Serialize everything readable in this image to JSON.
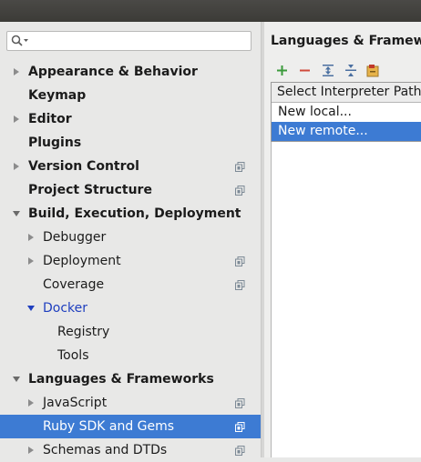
{
  "search": {
    "value": "",
    "placeholder": ""
  },
  "tree": [
    {
      "label": "Appearance & Behavior",
      "bold": true,
      "expander": "collapsed",
      "indent": 0,
      "project": false
    },
    {
      "label": "Keymap",
      "bold": true,
      "expander": "none",
      "indent": 0,
      "project": false
    },
    {
      "label": "Editor",
      "bold": true,
      "expander": "collapsed",
      "indent": 0,
      "project": false
    },
    {
      "label": "Plugins",
      "bold": true,
      "expander": "none",
      "indent": 0,
      "project": false
    },
    {
      "label": "Version Control",
      "bold": true,
      "expander": "collapsed",
      "indent": 0,
      "project": true
    },
    {
      "label": "Project Structure",
      "bold": true,
      "expander": "none",
      "indent": 0,
      "project": true
    },
    {
      "label": "Build, Execution, Deployment",
      "bold": true,
      "expander": "expanded",
      "indent": 0,
      "project": false
    },
    {
      "label": "Debugger",
      "bold": false,
      "expander": "collapsed",
      "indent": 1,
      "project": false
    },
    {
      "label": "Deployment",
      "bold": false,
      "expander": "collapsed",
      "indent": 1,
      "project": true
    },
    {
      "label": "Coverage",
      "bold": false,
      "expander": "none",
      "indent": 1,
      "project": true
    },
    {
      "label": "Docker",
      "bold": false,
      "expander": "expanded",
      "indent": 1,
      "project": false,
      "highlight": true
    },
    {
      "label": "Registry",
      "bold": false,
      "expander": "none",
      "indent": 2,
      "project": false
    },
    {
      "label": "Tools",
      "bold": false,
      "expander": "none",
      "indent": 2,
      "project": false
    },
    {
      "label": "Languages & Frameworks",
      "bold": true,
      "expander": "expanded",
      "indent": 0,
      "project": false
    },
    {
      "label": "JavaScript",
      "bold": false,
      "expander": "collapsed",
      "indent": 1,
      "project": true
    },
    {
      "label": "Ruby SDK and Gems",
      "bold": false,
      "expander": "none",
      "indent": 1,
      "project": true,
      "selected": true
    },
    {
      "label": "Schemas and DTDs",
      "bold": false,
      "expander": "collapsed",
      "indent": 1,
      "project": true
    }
  ],
  "right": {
    "title": "Languages & Framewor",
    "toolbar": [
      "add-icon",
      "remove-icon",
      "expand-all-icon",
      "collapse-all-icon",
      "import-icon"
    ],
    "popup": {
      "header": "Select Interpreter Path",
      "items": [
        "New local...",
        "New remote..."
      ],
      "highlighted_index": 1
    }
  },
  "colors": {
    "selection": "#3d7bd3",
    "highlight_text": "#1f3fbf",
    "add_icon": "#3b9a3b",
    "remove_icon": "#d04a3a"
  }
}
